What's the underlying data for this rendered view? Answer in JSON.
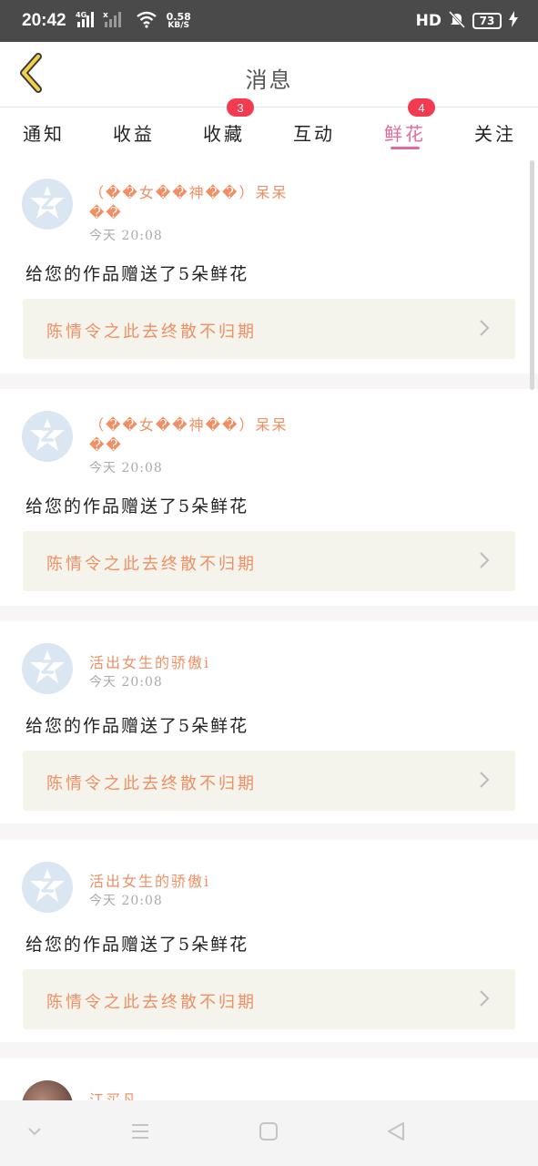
{
  "status_bar": {
    "time": "20:42",
    "network_type": "4G",
    "net_speed_value": "0.58",
    "net_speed_unit": "KB/S",
    "hd_label": "HD",
    "battery": "73"
  },
  "header": {
    "title": "消息"
  },
  "tabs": [
    {
      "label": "通知",
      "badge": ""
    },
    {
      "label": "收益",
      "badge": ""
    },
    {
      "label": "收藏",
      "badge": "3"
    },
    {
      "label": "互动",
      "badge": ""
    },
    {
      "label": "鲜花",
      "badge": "4",
      "active": true
    },
    {
      "label": "关注",
      "badge": ""
    }
  ],
  "messages": [
    {
      "username_line1": "（��女��神��）呆呆",
      "username_line2": "��",
      "time": "今天 20:08",
      "text": "给您的作品赠送了5朵鲜花",
      "work_title": "陈情令之此去终散不归期"
    },
    {
      "username_line1": "（��女��神��）呆呆",
      "username_line2": "��",
      "time": "今天 20:08",
      "text": "给您的作品赠送了5朵鲜花",
      "work_title": "陈情令之此去终散不归期"
    },
    {
      "username_line1": "活出女生的骄傲i",
      "time": "今天 20:08",
      "text": "给您的作品赠送了5朵鲜花",
      "work_title": "陈情令之此去终散不归期"
    },
    {
      "username_line1": "活出女生的骄傲i",
      "time": "今天 20:08",
      "text": "给您的作品赠送了5朵鲜花",
      "work_title": "陈情令之此去终散不归期"
    },
    {
      "username_line1": "江买凡"
    }
  ],
  "colors": {
    "accent": "#e8679a",
    "badge": "#f23b51",
    "username": "#ef8f63",
    "work_box_bg": "#f4f4ec"
  }
}
